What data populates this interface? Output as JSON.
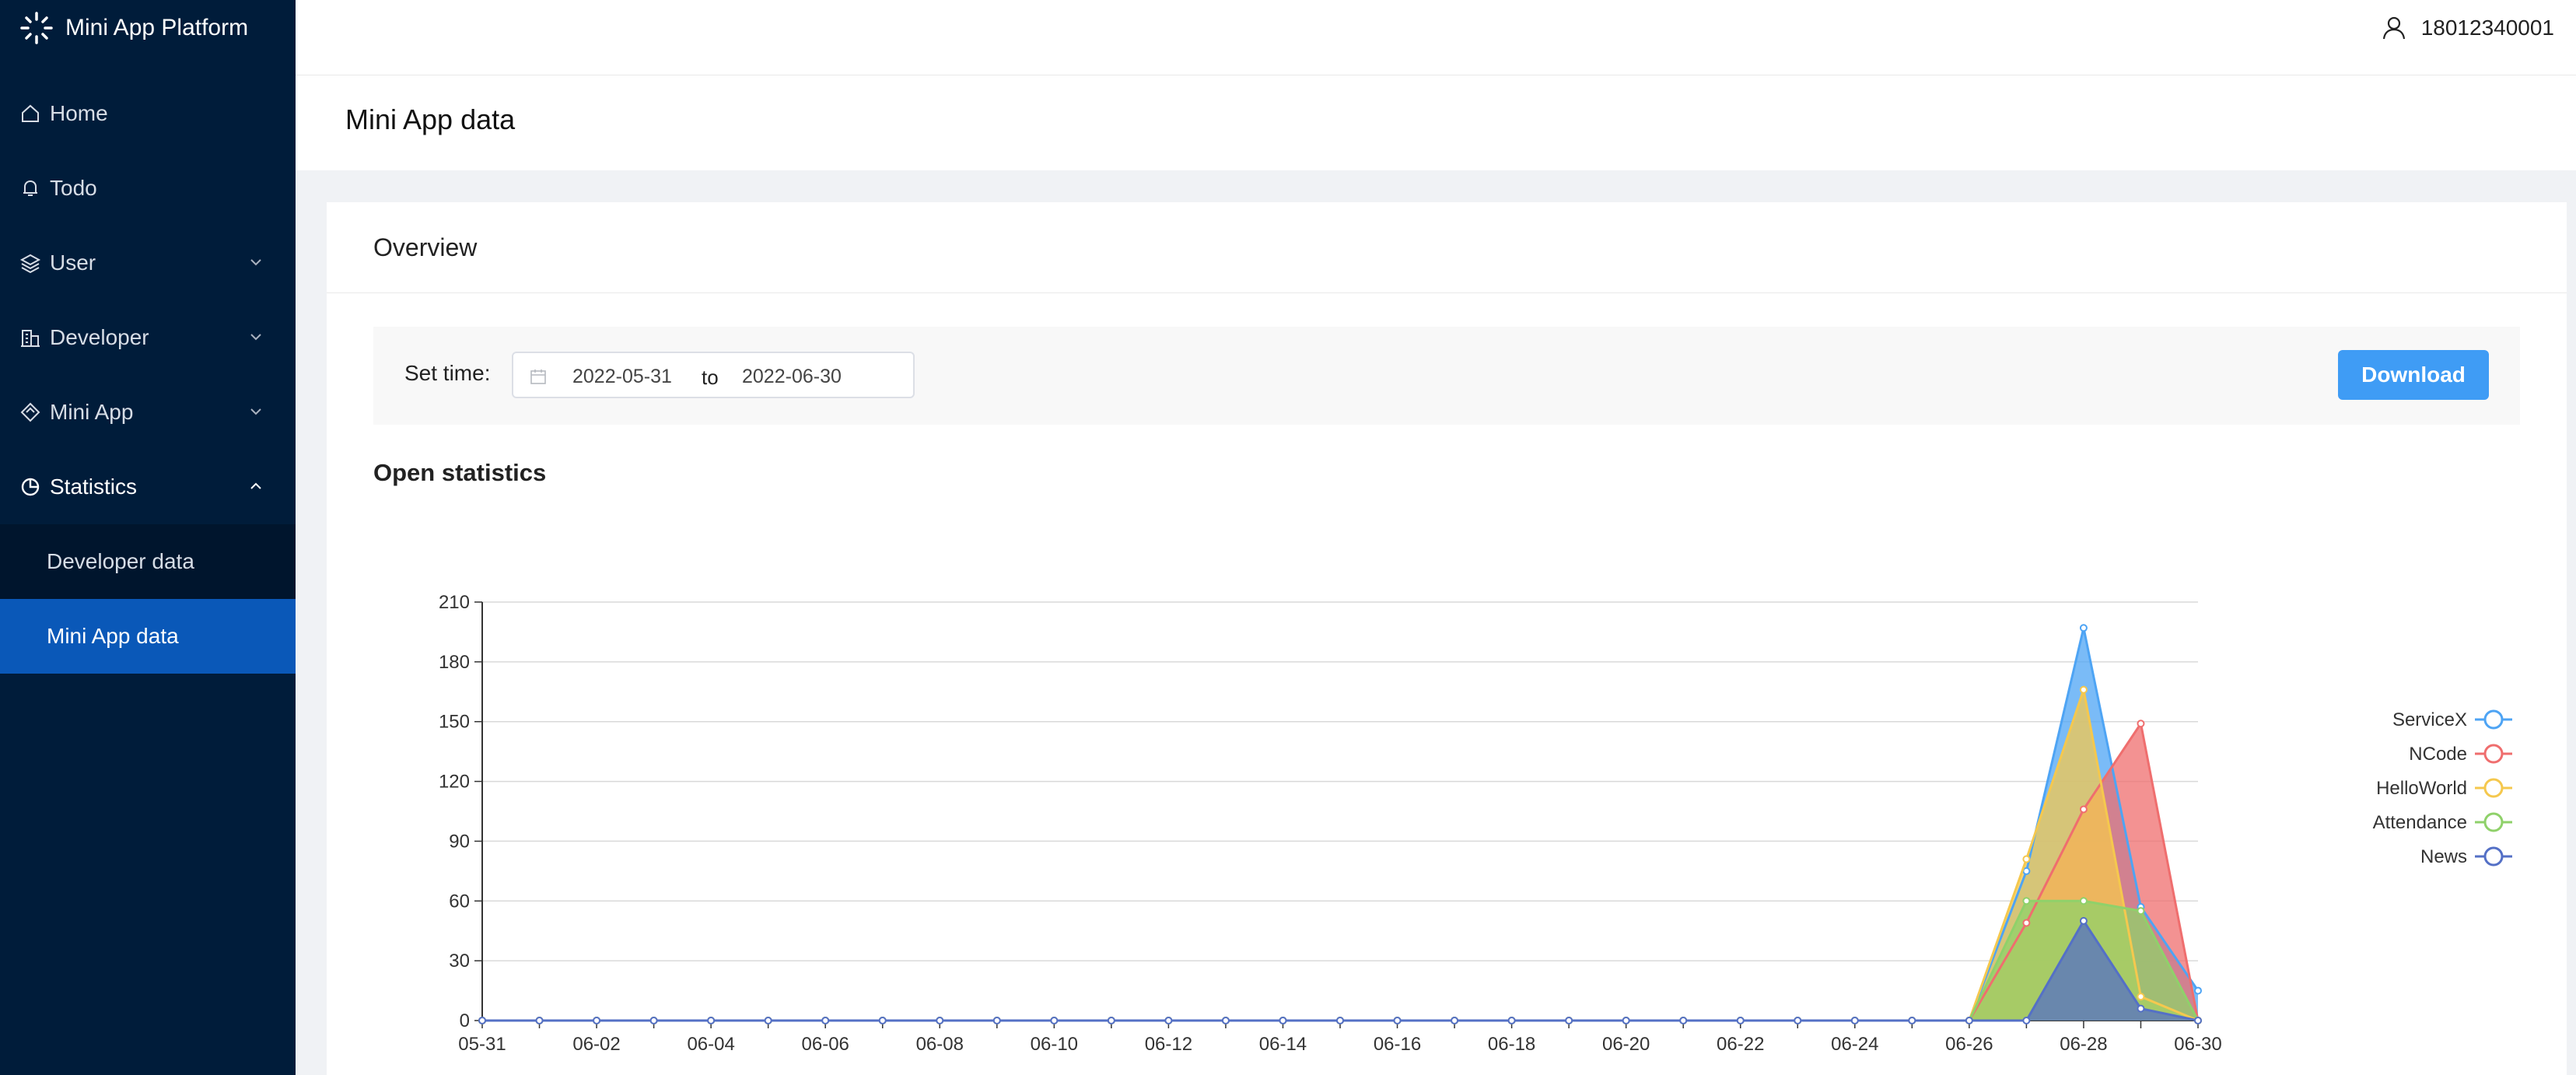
{
  "app": {
    "name": "Mini App Platform"
  },
  "user": {
    "name": "18012340001"
  },
  "sidebar": {
    "items": [
      {
        "label": "Home",
        "icon": "home-icon",
        "has_children": false
      },
      {
        "label": "Todo",
        "icon": "bell-icon",
        "has_children": false
      },
      {
        "label": "User",
        "icon": "layers-icon",
        "has_children": true
      },
      {
        "label": "Developer",
        "icon": "building-icon",
        "has_children": true
      },
      {
        "label": "Mini App",
        "icon": "diamond-icon",
        "has_children": true
      },
      {
        "label": "Statistics",
        "icon": "pie-chart-icon",
        "has_children": true,
        "expanded": true
      }
    ],
    "subitems": [
      {
        "label": "Developer data",
        "selected": false
      },
      {
        "label": "Mini App data",
        "selected": true
      }
    ]
  },
  "page": {
    "title": "Mini App data"
  },
  "overview": {
    "title": "Overview",
    "set_time_label": "Set time:",
    "date_from": "2022-05-31",
    "date_separator": "to",
    "date_to": "2022-06-30",
    "download_label": "Download"
  },
  "chart_section": {
    "title": "Open statistics"
  },
  "colors": {
    "sidebar_bg": "#001c3a",
    "selected_bg": "#0a58b8",
    "accent": "#3f9cf5"
  },
  "chart_data": {
    "type": "area",
    "x": [
      "05-31",
      "06-01",
      "06-02",
      "06-03",
      "06-04",
      "06-05",
      "06-06",
      "06-07",
      "06-08",
      "06-09",
      "06-10",
      "06-11",
      "06-12",
      "06-13",
      "06-14",
      "06-15",
      "06-16",
      "06-17",
      "06-18",
      "06-19",
      "06-20",
      "06-21",
      "06-22",
      "06-23",
      "06-24",
      "06-25",
      "06-26",
      "06-27",
      "06-28",
      "06-29",
      "06-30"
    ],
    "x_tick_labels": [
      "05-31",
      "06-02",
      "06-04",
      "06-06",
      "06-08",
      "06-10",
      "06-12",
      "06-14",
      "06-16",
      "06-18",
      "06-20",
      "06-22",
      "06-24",
      "06-26",
      "06-28",
      "06-30"
    ],
    "ylim": [
      0,
      210
    ],
    "y_ticks": [
      0,
      30,
      60,
      90,
      120,
      150,
      180,
      210
    ],
    "grid": true,
    "legend_position": "right",
    "series": [
      {
        "name": "ServiceX",
        "color": "#4ea4f4",
        "values": [
          0,
          0,
          0,
          0,
          0,
          0,
          0,
          0,
          0,
          0,
          0,
          0,
          0,
          0,
          0,
          0,
          0,
          0,
          0,
          0,
          0,
          0,
          0,
          0,
          0,
          0,
          0,
          75,
          197,
          57,
          15
        ]
      },
      {
        "name": "NCode",
        "color": "#ef6e6e",
        "values": [
          0,
          0,
          0,
          0,
          0,
          0,
          0,
          0,
          0,
          0,
          0,
          0,
          0,
          0,
          0,
          0,
          0,
          0,
          0,
          0,
          0,
          0,
          0,
          0,
          0,
          0,
          0,
          49,
          106,
          149,
          0
        ]
      },
      {
        "name": "HelloWorld",
        "color": "#f5c84e",
        "values": [
          0,
          0,
          0,
          0,
          0,
          0,
          0,
          0,
          0,
          0,
          0,
          0,
          0,
          0,
          0,
          0,
          0,
          0,
          0,
          0,
          0,
          0,
          0,
          0,
          0,
          0,
          0,
          81,
          166,
          12,
          0
        ]
      },
      {
        "name": "Attendance",
        "color": "#8fd16a",
        "values": [
          0,
          0,
          0,
          0,
          0,
          0,
          0,
          0,
          0,
          0,
          0,
          0,
          0,
          0,
          0,
          0,
          0,
          0,
          0,
          0,
          0,
          0,
          0,
          0,
          0,
          0,
          0,
          60,
          60,
          55,
          0
        ]
      },
      {
        "name": "News",
        "color": "#5470c6",
        "values": [
          0,
          0,
          0,
          0,
          0,
          0,
          0,
          0,
          0,
          0,
          0,
          0,
          0,
          0,
          0,
          0,
          0,
          0,
          0,
          0,
          0,
          0,
          0,
          0,
          0,
          0,
          0,
          0,
          50,
          6,
          0
        ]
      }
    ]
  }
}
